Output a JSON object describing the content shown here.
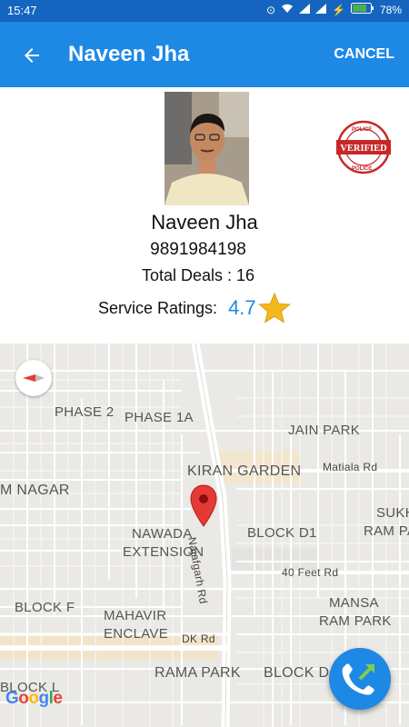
{
  "status": {
    "time": "15:47",
    "battery": "78%"
  },
  "appbar": {
    "title": "Naveen Jha",
    "cancel_label": "CANCEL"
  },
  "profile": {
    "name": "Naveen Jha",
    "phone": "9891984198",
    "deals": "Total Deals : 16",
    "rating_label": "Service Ratings:",
    "rating_value": "4.7",
    "badge_text": "VERIFIED",
    "badge_ring_text": "POLICE"
  },
  "map": {
    "labels": {
      "phase2": "PHASE 2",
      "phase1a": "PHASE 1A",
      "jain_park": "JAIN PARK",
      "kiran_garden": "KIRAN GARDEN",
      "matiala_rd": "Matiala Rd",
      "m_nagar": "M NAGAR",
      "sukh": "SUKH",
      "ram_pa": "RAM PA",
      "nawada": "NAWADA",
      "extension": "EXTENSION",
      "najafgarh_rd": "Najafgarh Rd",
      "block_d1": "BLOCK D1",
      "forty_feet_rd": "40 Feet Rd",
      "block_f": "BLOCK F",
      "mahavir": "MAHAVIR",
      "enclave": "ENCLAVE",
      "mansa": "MANSA",
      "ram_park": "RAM PARK",
      "dk_rd": "DK Rd",
      "block_l": "BLOCK L",
      "rama_park": "RAMA PARK",
      "block_d": "BLOCK D"
    },
    "google": {
      "g1": "G",
      "o1": "o",
      "o2": "o",
      "g2": "g",
      "l": "l",
      "e": "e"
    }
  },
  "colors": {
    "primary": "#1e88e5",
    "primary_dark": "#1565c0",
    "pin": "#e53935",
    "star": "#f5b81c"
  },
  "icons": {
    "back": "arrow-left-icon",
    "call": "call-transfer-icon",
    "compass": "compass-icon",
    "pin": "map-pin-icon"
  }
}
